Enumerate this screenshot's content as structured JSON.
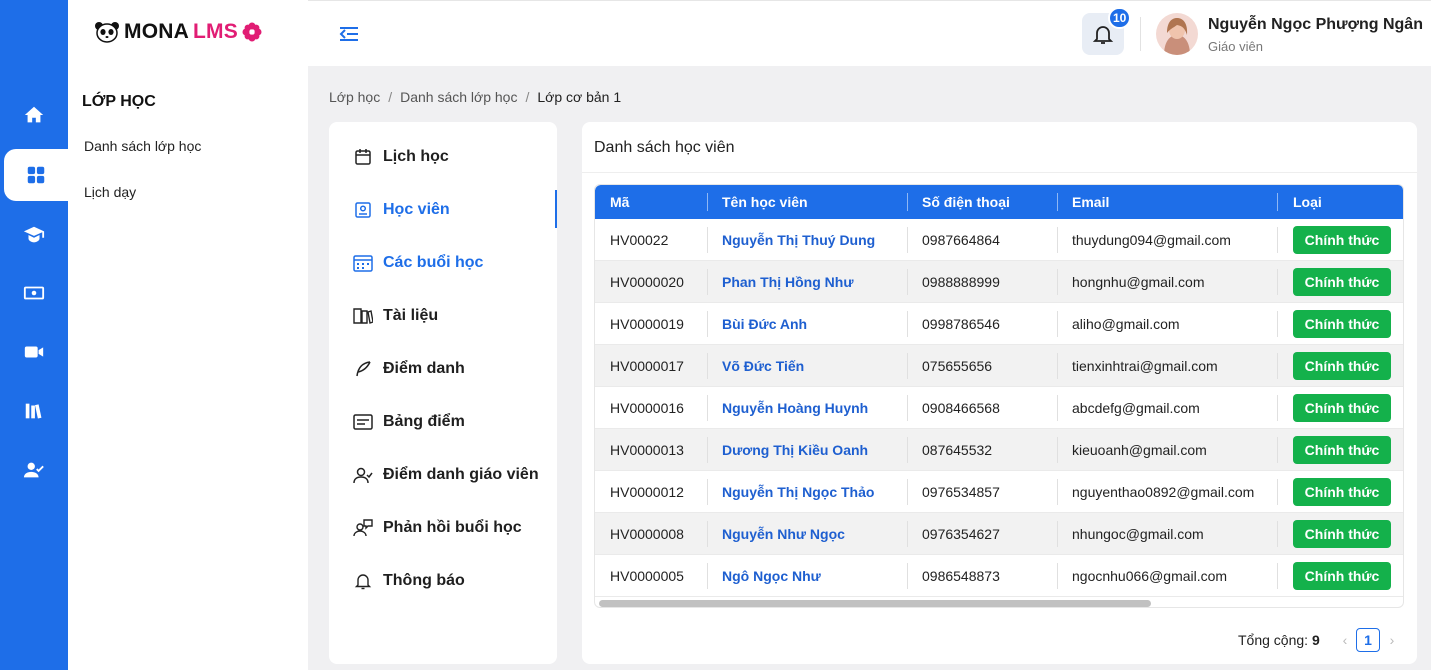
{
  "brand": {
    "name_part1": "MONA",
    "name_part2": "LMS",
    "accent": "#1e6ee8",
    "pink": "#e11d74"
  },
  "rail": {
    "items": [
      {
        "icon": "home-icon"
      },
      {
        "icon": "dashboard-grid-icon",
        "active": true
      },
      {
        "icon": "graduation-cap-icon"
      },
      {
        "icon": "money-icon"
      },
      {
        "icon": "video-camera-icon"
      },
      {
        "icon": "library-books-icon"
      },
      {
        "icon": "user-check-icon"
      }
    ]
  },
  "sidebar": {
    "title": "LỚP HỌC",
    "links": [
      "Danh sách lớp học",
      "Lịch dạy"
    ]
  },
  "header": {
    "notification_count": "10",
    "user_name": "Nguyễn Ngọc Phượng Ngân",
    "user_role": "Giáo viên"
  },
  "breadcrumb": [
    "Lớp học",
    "Danh sách lớp học",
    "Lớp cơ bản 1"
  ],
  "class_menu": [
    {
      "label": "Lịch học",
      "icon": "calendar-icon"
    },
    {
      "label": "Học viên",
      "icon": "student-card-icon",
      "active": true
    },
    {
      "label": "Các buổi học",
      "icon": "calendar-grid-icon"
    },
    {
      "label": "Tài liệu",
      "icon": "documents-icon"
    },
    {
      "label": "Điểm danh",
      "icon": "feather-icon"
    },
    {
      "label": "Bảng điểm",
      "icon": "scoreboard-icon"
    },
    {
      "label": "Điểm danh giáo viên",
      "icon": "teacher-check-icon"
    },
    {
      "label": "Phản hồi buổi học",
      "icon": "feedback-icon"
    },
    {
      "label": "Thông báo",
      "icon": "bell-icon"
    }
  ],
  "panel": {
    "title": "Danh sách học viên",
    "columns": [
      "Mã",
      "Tên học viên",
      "Số điện thoại",
      "Email",
      "Loại"
    ],
    "rows": [
      [
        "HV00022",
        "Nguyễn Thị Thuý Dung",
        "0987664864",
        "thuydung094@gmail.com",
        "Chính thức"
      ],
      [
        "HV0000020",
        "Phan Thị Hồng Như",
        "0988888999",
        "hongnhu@gmail.com",
        "Chính thức"
      ],
      [
        "HV0000019",
        "Bùi Đức Anh",
        "0998786546",
        "aliho@gmail.com",
        "Chính thức"
      ],
      [
        "HV0000017",
        "Võ Đức Tiến",
        "075655656",
        "tienxinhtrai@gmail.com",
        "Chính thức"
      ],
      [
        "HV0000016",
        "Nguyễn Hoàng Huynh",
        "0908466568",
        "abcdefg@gmail.com",
        "Chính thức"
      ],
      [
        "HV0000013",
        "Dương Thị Kiều Oanh",
        "087645532",
        "kieuoanh@gmail.com",
        "Chính thức"
      ],
      [
        "HV0000012",
        "Nguyễn Thị Ngọc Thảo",
        "0976534857",
        "nguyenthao0892@gmail.com",
        "Chính thức"
      ],
      [
        "HV0000008",
        "Nguyễn Như Ngọc",
        "0976354627",
        "nhungoc@gmail.com",
        "Chính thức"
      ],
      [
        "HV0000005",
        "Ngô Ngọc Như",
        "0986548873",
        "ngocnhu066@gmail.com",
        "Chính thức"
      ]
    ],
    "total_label": "Tổng cộng:",
    "total_value": "9",
    "current_page": "1",
    "prev": "‹",
    "next": "›"
  }
}
